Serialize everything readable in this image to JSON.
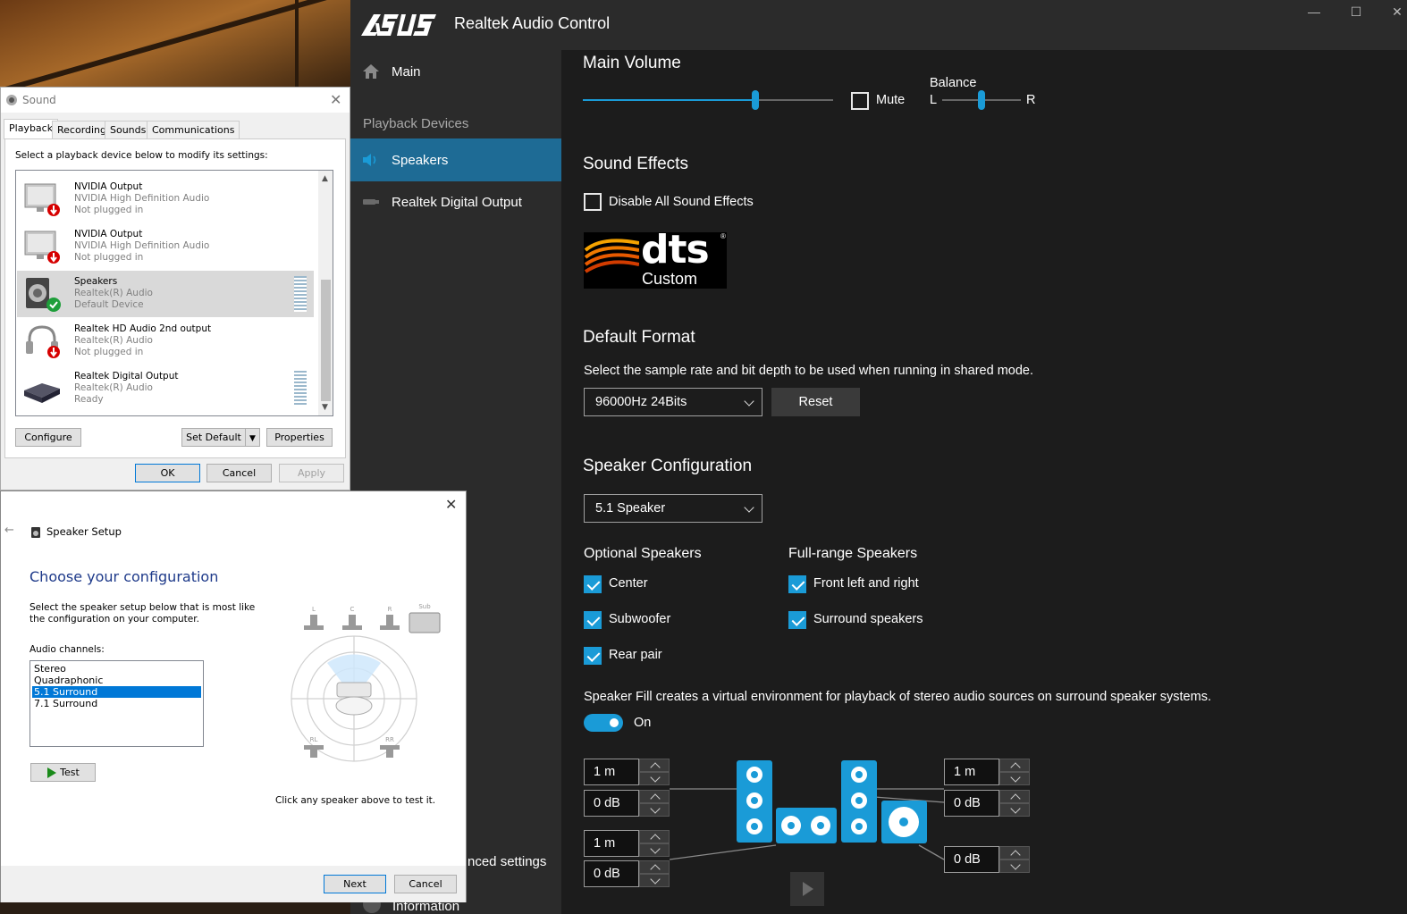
{
  "realtek": {
    "app_title": "Realtek Audio Control",
    "nav": {
      "main": "Main",
      "section_label": "Playback Devices",
      "speakers": "Speakers",
      "digital_output": "Realtek Digital Output",
      "advanced_settings_partial": "nced settings",
      "information_partial": "Information"
    },
    "main_volume": {
      "title": "Main Volume",
      "volume_fraction": 0.69,
      "mute_label": "Mute",
      "mute_checked": false,
      "balance_label": "Balance",
      "balance_left": "L",
      "balance_right": "R",
      "balance_fraction": 0.5
    },
    "sound_effects": {
      "title": "Sound Effects",
      "disable_all_label": "Disable All Sound Effects",
      "disable_all_checked": false,
      "dts_text": "dts",
      "dts_sub": "Custom",
      "dts_reg": "®"
    },
    "default_format": {
      "title": "Default Format",
      "description": "Select the sample rate and bit depth to be used when running in shared mode.",
      "selected": "96000Hz 24Bits",
      "reset_label": "Reset"
    },
    "speaker_config": {
      "title": "Speaker Configuration",
      "selected": "5.1 Speaker",
      "optional_title": "Optional Speakers",
      "optional": [
        {
          "label": "Center",
          "checked": true
        },
        {
          "label": "Subwoofer",
          "checked": true
        },
        {
          "label": "Rear pair",
          "checked": true
        }
      ],
      "fullrange_title": "Full-range Speakers",
      "fullrange": [
        {
          "label": "Front left and right",
          "checked": true
        },
        {
          "label": "Surround speakers",
          "checked": true
        }
      ],
      "fill_description": "Speaker Fill creates a virtual environment for playback of stereo audio sources on surround speaker systems.",
      "fill_toggle_label": "On",
      "fill_on": true
    },
    "spinners": {
      "left_front_distance": "1 m",
      "left_front_gain": "0 dB",
      "left_rear_distance": "1 m",
      "left_rear_gain": "0 dB",
      "right_front_distance": "1 m",
      "right_front_gain": "0 dB",
      "sub_gain": "0 dB"
    },
    "colors": {
      "accent": "#1a9bd7",
      "nav_bg": "#2b2b2b",
      "main_bg": "#1c1c1c",
      "nav_active": "#1e6b95"
    }
  },
  "sound_dialog": {
    "title": "Sound",
    "tabs": [
      "Playback",
      "Recording",
      "Sounds",
      "Communications"
    ],
    "instruction": "Select a playback device below to modify its settings:",
    "devices": [
      {
        "name": "NVIDIA Output",
        "line2": "NVIDIA High Definition Audio",
        "line3": "Not plugged in",
        "icon": "monitor-icon",
        "status": "unplugged"
      },
      {
        "name": "NVIDIA Output",
        "line2": "NVIDIA High Definition Audio",
        "line3": "Not plugged in",
        "icon": "monitor-icon",
        "status": "unplugged"
      },
      {
        "name": "Speakers",
        "line2": "Realtek(R) Audio",
        "line3": "Default Device",
        "icon": "speaker-icon",
        "status": "default"
      },
      {
        "name": "Realtek HD Audio 2nd output",
        "line2": "Realtek(R) Audio",
        "line3": "Not plugged in",
        "icon": "headphones-icon",
        "status": "unplugged"
      },
      {
        "name": "Realtek Digital Output",
        "line2": "Realtek(R) Audio",
        "line3": "Ready",
        "icon": "digital-output-icon",
        "status": "ready"
      }
    ],
    "buttons": {
      "configure": "Configure",
      "set_default": "Set Default",
      "properties": "Properties",
      "ok": "OK",
      "cancel": "Cancel",
      "apply": "Apply"
    }
  },
  "speaker_setup": {
    "title": "Speaker Setup",
    "heading": "Choose your configuration",
    "instruction": "Select the speaker setup below that is most like the configuration on your computer.",
    "channels_label": "Audio channels:",
    "channels": [
      "Stereo",
      "Quadraphonic",
      "5.1 Surround",
      "7.1 Surround"
    ],
    "selected_channel": "5.1 Surround",
    "test_label": "Test",
    "hint": "Click any speaker above to test it.",
    "speaker_labels": {
      "l": "L",
      "c": "C",
      "r": "R",
      "sub": "Sub",
      "rl": "RL",
      "rr": "RR"
    },
    "next_label": "Next",
    "cancel_label": "Cancel"
  }
}
